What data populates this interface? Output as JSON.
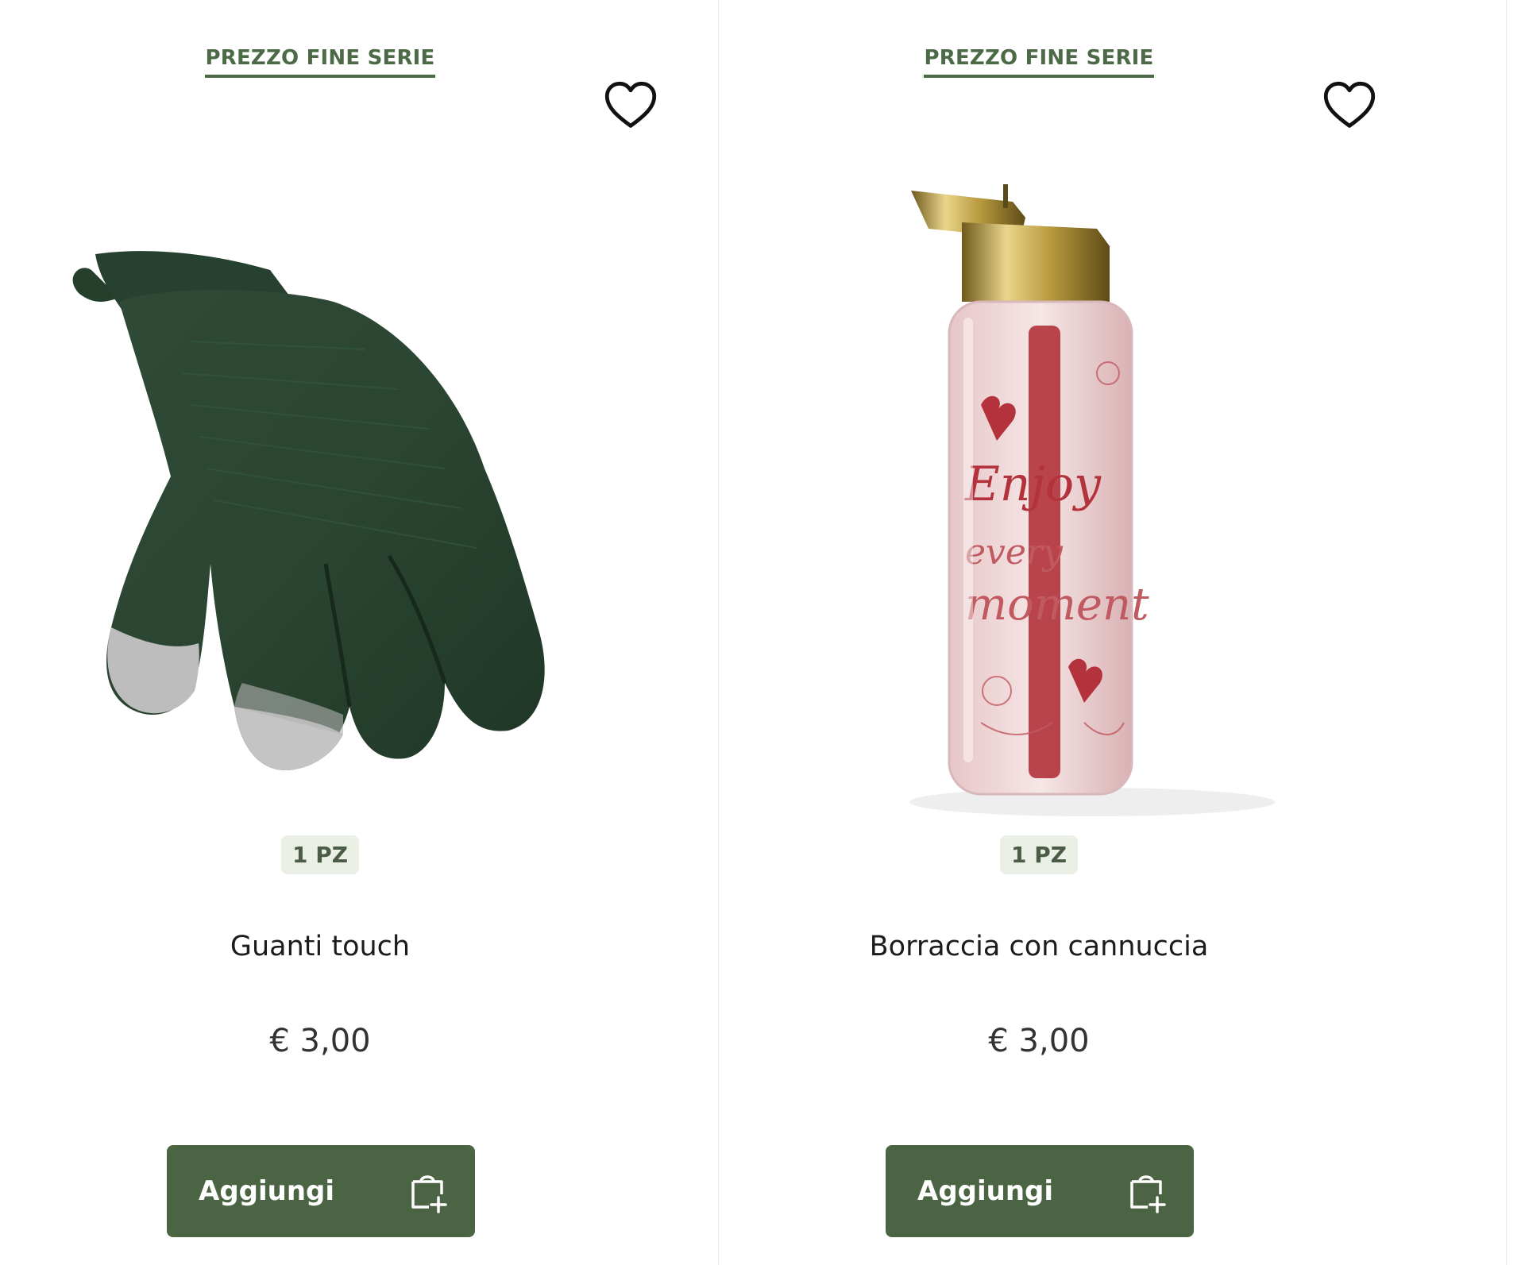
{
  "colors": {
    "accent": "#4b6a45",
    "button_bg": "#4b6443",
    "badge_bg": "#eaf0e6",
    "text": "#1c1c1c"
  },
  "products": [
    {
      "promo_label": "PREZZO FINE SERIE",
      "favorite_icon": "heart-outline-icon",
      "image": "green-touch-gloves",
      "quantity_badge": "1 PZ",
      "name": "Guanti touch",
      "price": "€ 3,00",
      "add_label": "Aggiungi",
      "add_icon": "shopping-bag-plus-icon"
    },
    {
      "promo_label": "PREZZO FINE SERIE",
      "favorite_icon": "heart-outline-icon",
      "image": "pink-water-bottle-with-straw",
      "quantity_badge": "1 PZ",
      "name": "Borraccia con cannuccia",
      "price": "€ 3,00",
      "add_label": "Aggiungi",
      "add_icon": "shopping-bag-plus-icon"
    }
  ]
}
